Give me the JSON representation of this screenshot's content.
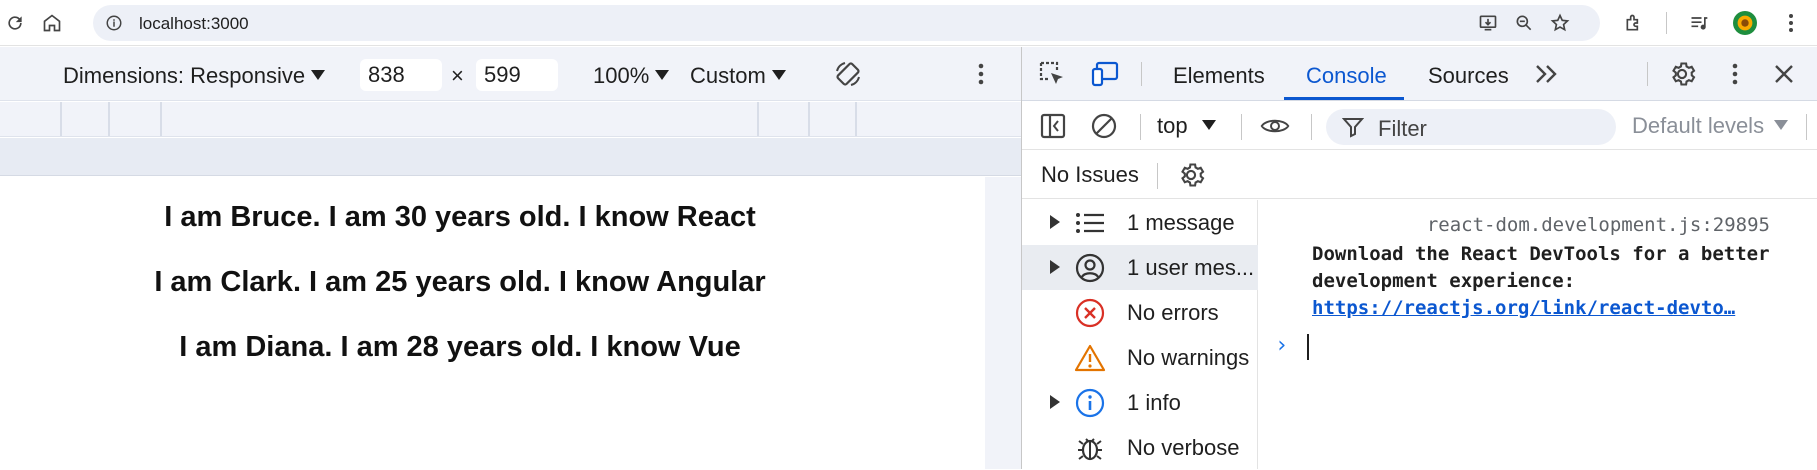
{
  "browser": {
    "url": "localhost:3000"
  },
  "device_toolbar": {
    "dimensions_label": "Dimensions: Responsive",
    "width": "838",
    "times": "×",
    "height": "599",
    "zoom": "100%",
    "throttle": "Custom"
  },
  "page": {
    "lines": [
      "I am Bruce. I am 30 years old. I know React",
      "I am Clark. I am 25 years old. I know Angular",
      "I am Diana. I am 28 years old. I know Vue"
    ]
  },
  "devtools": {
    "tabs": [
      "Elements",
      "Console",
      "Sources"
    ],
    "active_tab": "Console",
    "context": "top",
    "filter_placeholder": "Filter",
    "levels": "Default levels",
    "issues": "No Issues",
    "sidebar": [
      {
        "label": "1 message",
        "icon": "list-icon",
        "expandable": true
      },
      {
        "label": "1 user mes...",
        "icon": "user-icon",
        "expandable": true,
        "selected": true
      },
      {
        "label": "No errors",
        "icon": "error-icon",
        "expandable": false
      },
      {
        "label": "No warnings",
        "icon": "warning-icon",
        "expandable": false
      },
      {
        "label": "1 info",
        "icon": "info-icon",
        "expandable": true
      },
      {
        "label": "No verbose",
        "icon": "bug-icon",
        "expandable": false
      }
    ],
    "console": {
      "source": "react-dom.development.js:29895",
      "message": "Download the React DevTools for a better development experience:",
      "link": "https://reactjs.org/link/react-devto…",
      "prompt": "›"
    }
  },
  "colors": {
    "accent": "#0b57d0",
    "error": "#d93025",
    "warning": "#e37400",
    "info": "#1a73e8"
  }
}
